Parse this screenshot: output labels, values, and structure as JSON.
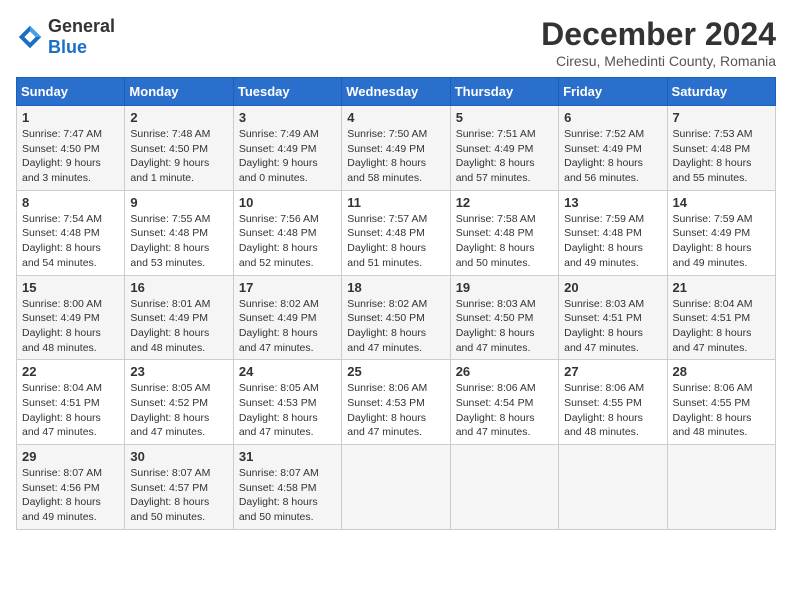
{
  "header": {
    "logo_general": "General",
    "logo_blue": "Blue",
    "month_title": "December 2024",
    "subtitle": "Ciresu, Mehedinti County, Romania"
  },
  "weekdays": [
    "Sunday",
    "Monday",
    "Tuesday",
    "Wednesday",
    "Thursday",
    "Friday",
    "Saturday"
  ],
  "weeks": [
    [
      {
        "day": "1",
        "detail": "Sunrise: 7:47 AM\nSunset: 4:50 PM\nDaylight: 9 hours\nand 3 minutes."
      },
      {
        "day": "2",
        "detail": "Sunrise: 7:48 AM\nSunset: 4:50 PM\nDaylight: 9 hours\nand 1 minute."
      },
      {
        "day": "3",
        "detail": "Sunrise: 7:49 AM\nSunset: 4:49 PM\nDaylight: 9 hours\nand 0 minutes."
      },
      {
        "day": "4",
        "detail": "Sunrise: 7:50 AM\nSunset: 4:49 PM\nDaylight: 8 hours\nand 58 minutes."
      },
      {
        "day": "5",
        "detail": "Sunrise: 7:51 AM\nSunset: 4:49 PM\nDaylight: 8 hours\nand 57 minutes."
      },
      {
        "day": "6",
        "detail": "Sunrise: 7:52 AM\nSunset: 4:49 PM\nDaylight: 8 hours\nand 56 minutes."
      },
      {
        "day": "7",
        "detail": "Sunrise: 7:53 AM\nSunset: 4:48 PM\nDaylight: 8 hours\nand 55 minutes."
      }
    ],
    [
      {
        "day": "8",
        "detail": "Sunrise: 7:54 AM\nSunset: 4:48 PM\nDaylight: 8 hours\nand 54 minutes."
      },
      {
        "day": "9",
        "detail": "Sunrise: 7:55 AM\nSunset: 4:48 PM\nDaylight: 8 hours\nand 53 minutes."
      },
      {
        "day": "10",
        "detail": "Sunrise: 7:56 AM\nSunset: 4:48 PM\nDaylight: 8 hours\nand 52 minutes."
      },
      {
        "day": "11",
        "detail": "Sunrise: 7:57 AM\nSunset: 4:48 PM\nDaylight: 8 hours\nand 51 minutes."
      },
      {
        "day": "12",
        "detail": "Sunrise: 7:58 AM\nSunset: 4:48 PM\nDaylight: 8 hours\nand 50 minutes."
      },
      {
        "day": "13",
        "detail": "Sunrise: 7:59 AM\nSunset: 4:48 PM\nDaylight: 8 hours\nand 49 minutes."
      },
      {
        "day": "14",
        "detail": "Sunrise: 7:59 AM\nSunset: 4:49 PM\nDaylight: 8 hours\nand 49 minutes."
      }
    ],
    [
      {
        "day": "15",
        "detail": "Sunrise: 8:00 AM\nSunset: 4:49 PM\nDaylight: 8 hours\nand 48 minutes."
      },
      {
        "day": "16",
        "detail": "Sunrise: 8:01 AM\nSunset: 4:49 PM\nDaylight: 8 hours\nand 48 minutes."
      },
      {
        "day": "17",
        "detail": "Sunrise: 8:02 AM\nSunset: 4:49 PM\nDaylight: 8 hours\nand 47 minutes."
      },
      {
        "day": "18",
        "detail": "Sunrise: 8:02 AM\nSunset: 4:50 PM\nDaylight: 8 hours\nand 47 minutes."
      },
      {
        "day": "19",
        "detail": "Sunrise: 8:03 AM\nSunset: 4:50 PM\nDaylight: 8 hours\nand 47 minutes."
      },
      {
        "day": "20",
        "detail": "Sunrise: 8:03 AM\nSunset: 4:51 PM\nDaylight: 8 hours\nand 47 minutes."
      },
      {
        "day": "21",
        "detail": "Sunrise: 8:04 AM\nSunset: 4:51 PM\nDaylight: 8 hours\nand 47 minutes."
      }
    ],
    [
      {
        "day": "22",
        "detail": "Sunrise: 8:04 AM\nSunset: 4:51 PM\nDaylight: 8 hours\nand 47 minutes."
      },
      {
        "day": "23",
        "detail": "Sunrise: 8:05 AM\nSunset: 4:52 PM\nDaylight: 8 hours\nand 47 minutes."
      },
      {
        "day": "24",
        "detail": "Sunrise: 8:05 AM\nSunset: 4:53 PM\nDaylight: 8 hours\nand 47 minutes."
      },
      {
        "day": "25",
        "detail": "Sunrise: 8:06 AM\nSunset: 4:53 PM\nDaylight: 8 hours\nand 47 minutes."
      },
      {
        "day": "26",
        "detail": "Sunrise: 8:06 AM\nSunset: 4:54 PM\nDaylight: 8 hours\nand 47 minutes."
      },
      {
        "day": "27",
        "detail": "Sunrise: 8:06 AM\nSunset: 4:55 PM\nDaylight: 8 hours\nand 48 minutes."
      },
      {
        "day": "28",
        "detail": "Sunrise: 8:06 AM\nSunset: 4:55 PM\nDaylight: 8 hours\nand 48 minutes."
      }
    ],
    [
      {
        "day": "29",
        "detail": "Sunrise: 8:07 AM\nSunset: 4:56 PM\nDaylight: 8 hours\nand 49 minutes."
      },
      {
        "day": "30",
        "detail": "Sunrise: 8:07 AM\nSunset: 4:57 PM\nDaylight: 8 hours\nand 50 minutes."
      },
      {
        "day": "31",
        "detail": "Sunrise: 8:07 AM\nSunset: 4:58 PM\nDaylight: 8 hours\nand 50 minutes."
      },
      null,
      null,
      null,
      null
    ]
  ]
}
